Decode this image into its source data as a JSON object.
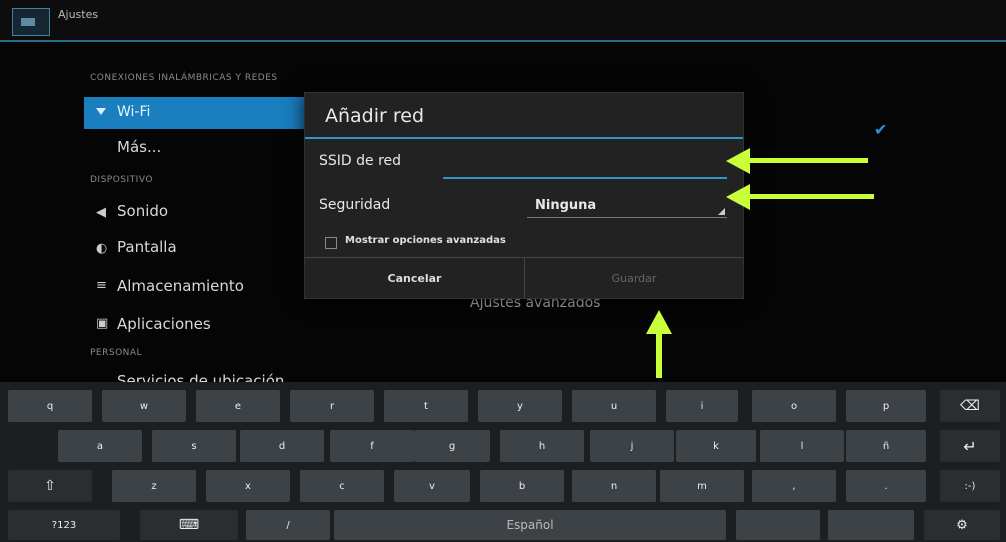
{
  "app": {
    "title": "Ajustes"
  },
  "settings": {
    "section_wireless": "CONEXIONES INALÁMBRICAS Y REDES",
    "section_wireless_suffix": "Wi-Fi",
    "wifi": "Wi-Fi",
    "mas": "Más...",
    "section_device": "DISPOSITIVO",
    "sonido": "Sonido",
    "pantalla": "Pantalla",
    "almacenamiento": "Almacenamiento",
    "aplicaciones": "Aplicaciones",
    "section_personal": "PERSONAL",
    "ubicacion": "Servicios de ubicación",
    "advanced": "Ajustes avanzados"
  },
  "dialog": {
    "title": "Añadir red",
    "ssid_label": "SSID de red",
    "ssid_value": "",
    "security_label": "Seguridad",
    "security_value": "Ninguna",
    "advanced_options": "Mostrar opciones avanzadas",
    "cancel": "Cancelar",
    "save": "Guardar"
  },
  "keyboard": {
    "row1": [
      "q",
      "w",
      "e",
      "r",
      "t",
      "y",
      "u",
      "i",
      "o",
      "p"
    ],
    "row2": [
      "a",
      "s",
      "d",
      "f",
      "g",
      "h",
      "j",
      "k",
      "l",
      "ñ"
    ],
    "row3": [
      "z",
      "x",
      "c",
      "v",
      "b",
      "n",
      "m",
      ",",
      "."
    ],
    "symbols_key": "?123",
    "space_label": "Español",
    "slash_key": "/",
    "smiley_key": ":-)"
  },
  "colors": {
    "accent": "#2f96c9",
    "highlight": "#1a7fbf",
    "arrow": "#c8ff3a"
  }
}
